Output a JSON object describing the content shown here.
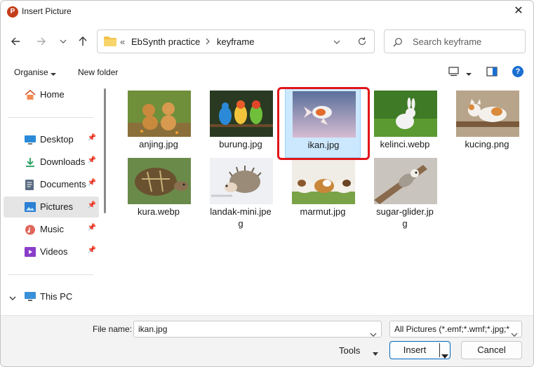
{
  "window": {
    "title": "Insert Picture",
    "app_icon_letter": "P",
    "close_glyph": "✕"
  },
  "nav": {
    "path": [
      "EbSynth practice",
      "keyframe"
    ],
    "overflow": "«",
    "search_placeholder": "Search keyframe"
  },
  "toolbar": {
    "organise_label": "Organise",
    "new_folder_label": "New folder",
    "help_glyph": "?"
  },
  "sidebar": {
    "items": [
      {
        "label": "Home"
      },
      {
        "label": "Desktop",
        "pinned": true
      },
      {
        "label": "Downloads",
        "pinned": true
      },
      {
        "label": "Documents",
        "pinned": true
      },
      {
        "label": "Pictures",
        "pinned": true,
        "selected": true
      },
      {
        "label": "Music",
        "pinned": true
      },
      {
        "label": "Videos",
        "pinned": true
      },
      {
        "label": "This PC"
      }
    ]
  },
  "files": [
    {
      "name": "anjing.jpg"
    },
    {
      "name": "burung.jpg"
    },
    {
      "name": "ikan.jpg",
      "selected": true
    },
    {
      "name": "kelinci.webp"
    },
    {
      "name": "kucing.png"
    },
    {
      "name": "kura.webp"
    },
    {
      "name": "landak-mini.jpe",
      "name2": "g"
    },
    {
      "name": "marmut.jpg"
    },
    {
      "name": "sugar-glider.jp",
      "name2": "g"
    }
  ],
  "footer": {
    "file_name_label": "File name:",
    "file_name_value": "ikan.jpg",
    "filter_value": "All Pictures (*.emf;*.wmf;*.jpg;*",
    "tools_label": "Tools",
    "insert_label": "Insert",
    "cancel_label": "Cancel"
  },
  "colors": {
    "selection": "#cce8ff",
    "highlight_box": "#e0151a",
    "accent": "#0067c0"
  }
}
